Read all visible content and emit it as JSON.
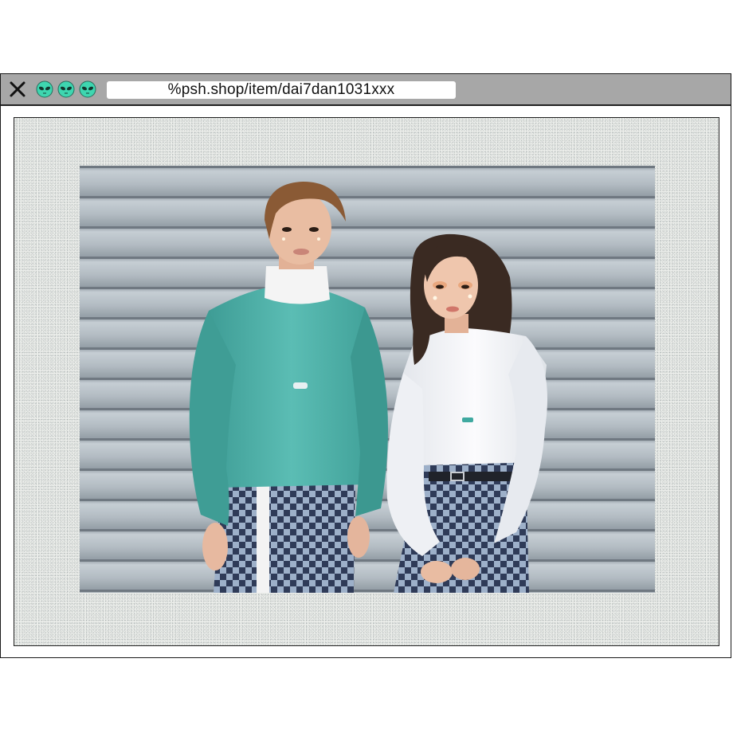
{
  "browser": {
    "url": "%psh.shop/item/dai7dan1031xxx",
    "close_icon": "close-icon",
    "window_buttons": [
      "alien-icon",
      "alien-icon",
      "alien-icon"
    ],
    "titlebar_color": "#a7a7a7",
    "alien_color": "#3ed6b0"
  },
  "photo": {
    "subject": "two models in teal and white sweatshirts with checkered pants against a grey metal shutter",
    "shutter_color": "#a9b3bc",
    "teal_sweatshirt_color": "#4fb3ab",
    "checker_color": "#3c4a66"
  }
}
